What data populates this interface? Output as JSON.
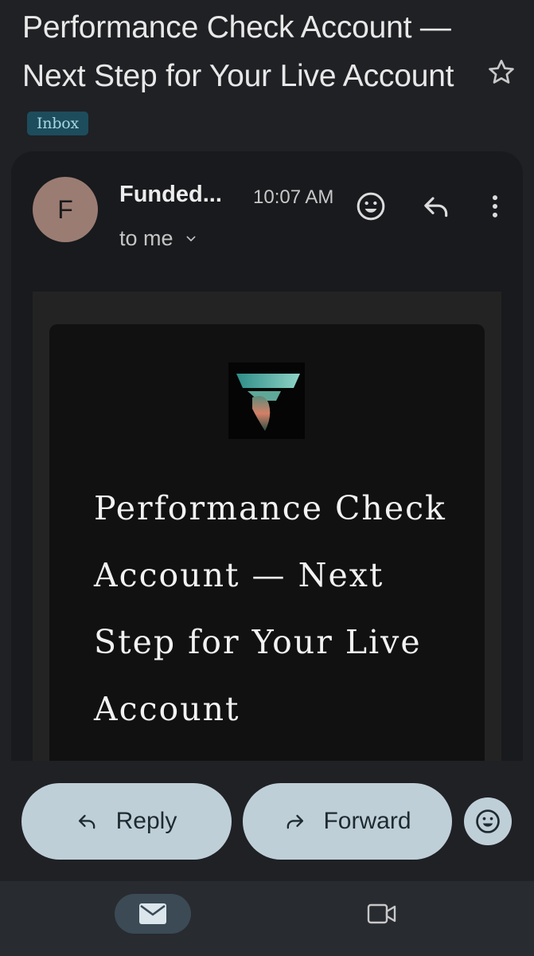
{
  "subject": {
    "title": "Performance Check Account — Next Step for Your Live Account",
    "label_badge": "Inbox"
  },
  "message": {
    "avatar_letter": "F",
    "sender": "Funded...",
    "time": "10:07 AM",
    "recipient": "to me"
  },
  "email_body": {
    "heading": "Performance Check Account — Next Step for Your Live Account"
  },
  "actions": {
    "reply_label": "Reply",
    "forward_label": "Forward"
  },
  "icons": {
    "star": "star-icon",
    "emoji": "emoji-icon",
    "reply": "reply-icon",
    "more": "more-vert-icon",
    "chevron": "chevron-down-icon",
    "forward": "forward-icon",
    "mail": "mail-icon",
    "meet": "video-icon"
  },
  "colors": {
    "background": "#1f2125",
    "pill": "#bfcfd8",
    "badge": "#1d4d5c"
  }
}
